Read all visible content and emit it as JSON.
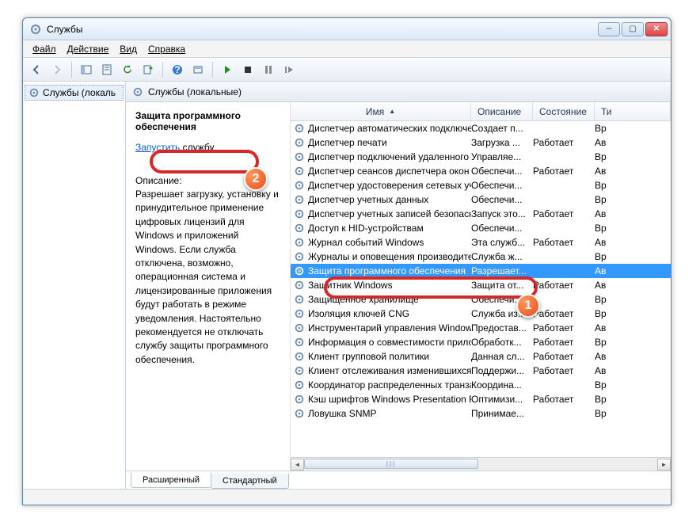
{
  "window": {
    "title": "Службы"
  },
  "menu": {
    "file": "Файл",
    "action": "Действие",
    "view": "Вид",
    "help": "Справка"
  },
  "tree": {
    "item": "Службы (локаль"
  },
  "main_header": "Службы (локальные)",
  "detail": {
    "title": "Защита программного обеспечения",
    "start_link": "Запустить",
    "start_suffix": " службу",
    "desc_label": "Описание:",
    "desc": "Разрешает загрузку, установку и принудительное применение цифровых лицензий для Windows и приложений Windows. Если служба отключена, возможно, операционная система и лицензированные приложения будут работать в режиме уведомления. Настоятельно рекомендуется не отключать службу защиты программного обеспечения."
  },
  "columns": {
    "name": "Имя",
    "desc": "Описание",
    "state": "Состояние",
    "type": "Ти"
  },
  "services": [
    {
      "name": "Диспетчер автоматических подключени...",
      "desc": "Создает п...",
      "state": "",
      "type": "Вр"
    },
    {
      "name": "Диспетчер печати",
      "desc": "Загрузка ...",
      "state": "Работает",
      "type": "Ав"
    },
    {
      "name": "Диспетчер подключений удаленного до...",
      "desc": "Управляе...",
      "state": "",
      "type": "Вр"
    },
    {
      "name": "Диспетчер сеансов диспетчера окон раб...",
      "desc": "Обеспечи...",
      "state": "Работает",
      "type": "Ав"
    },
    {
      "name": "Диспетчер удостоверения сетевых участ...",
      "desc": "Обеспечи...",
      "state": "",
      "type": "Вр"
    },
    {
      "name": "Диспетчер учетных данных",
      "desc": "Обеспечи...",
      "state": "",
      "type": "Вр"
    },
    {
      "name": "Диспетчер учетных записей безопасности",
      "desc": "Запуск это...",
      "state": "Работает",
      "type": "Ав"
    },
    {
      "name": "Доступ к HID-устройствам",
      "desc": "Обеспечи...",
      "state": "",
      "type": "Вр"
    },
    {
      "name": "Журнал событий Windows",
      "desc": "Эта служб...",
      "state": "Работает",
      "type": "Ав"
    },
    {
      "name": "Журналы и оповещения производител...",
      "desc": "Служба ж...",
      "state": "",
      "type": "Вр"
    },
    {
      "name": "Защита программного обеспечения",
      "desc": "Разрешает...",
      "state": "",
      "type": "Ав",
      "selected": true
    },
    {
      "name": "Защитник Windows",
      "desc": "Защита от...",
      "state": "Работает",
      "type": "Ав"
    },
    {
      "name": "Защищенное хранилище",
      "desc": "Обеспечи...",
      "state": "",
      "type": "Вр"
    },
    {
      "name": "Изоляция ключей CNG",
      "desc": "Служба из...",
      "state": "Работает",
      "type": "Вр"
    },
    {
      "name": "Инструментарий управления Windows",
      "desc": "Предостав...",
      "state": "Работает",
      "type": "Ав"
    },
    {
      "name": "Информация о совместимости приложе...",
      "desc": "Обработк...",
      "state": "Работает",
      "type": "Вр"
    },
    {
      "name": "Клиент групповой политики",
      "desc": "Данная сл...",
      "state": "Работает",
      "type": "Ав"
    },
    {
      "name": "Клиент отслеживания изменившихся св...",
      "desc": "Поддержи...",
      "state": "Работает",
      "type": "Ав"
    },
    {
      "name": "Координатор распределенных транзакций",
      "desc": "Координа...",
      "state": "",
      "type": "Вр"
    },
    {
      "name": "Кэш шрифтов Windows Presentation Fou...",
      "desc": "Оптимизи...",
      "state": "Работает",
      "type": "Вр"
    },
    {
      "name": "Ловушка SNMP",
      "desc": "Принимае...",
      "state": "",
      "type": "Вр"
    }
  ],
  "tabs": {
    "extended": "Расширенный",
    "standard": "Стандартный"
  },
  "badges": {
    "b1": "1",
    "b2": "2"
  }
}
